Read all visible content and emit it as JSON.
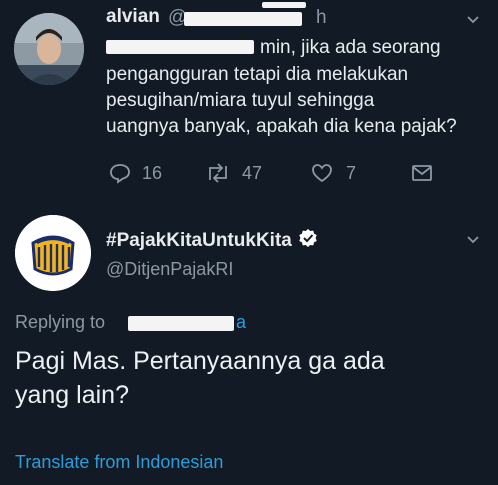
{
  "reply_tweet": {
    "author_name": "alvian",
    "handle_prefix": "@",
    "time_suffix": "h",
    "text_line1_tail": "min, jika ada seorang",
    "text_lines": [
      "pengangguran tetapi dia melakukan",
      "pesugihan/miara tuyul sehingga",
      "uangnya banyak, apakah dia kena pajak?"
    ],
    "replies_count": "16",
    "retweets_count": "47",
    "likes_count": "7"
  },
  "main_tweet": {
    "display_name": "#PajakKitaUntukKita",
    "handle": "@DitjenPajakRI",
    "replying_to_label": "Replying to",
    "replying_to_handle_tail": "a",
    "text_line1": "Pagi Mas. Pertanyaannya ga ada",
    "text_line2": "yang lain?",
    "translate_label": "Translate from Indonesian"
  },
  "colors": {
    "background": "#121b25",
    "text": "#e7ebee",
    "muted": "#8b98a5",
    "link": "#2f9bd9",
    "verified": "#ffffff"
  }
}
